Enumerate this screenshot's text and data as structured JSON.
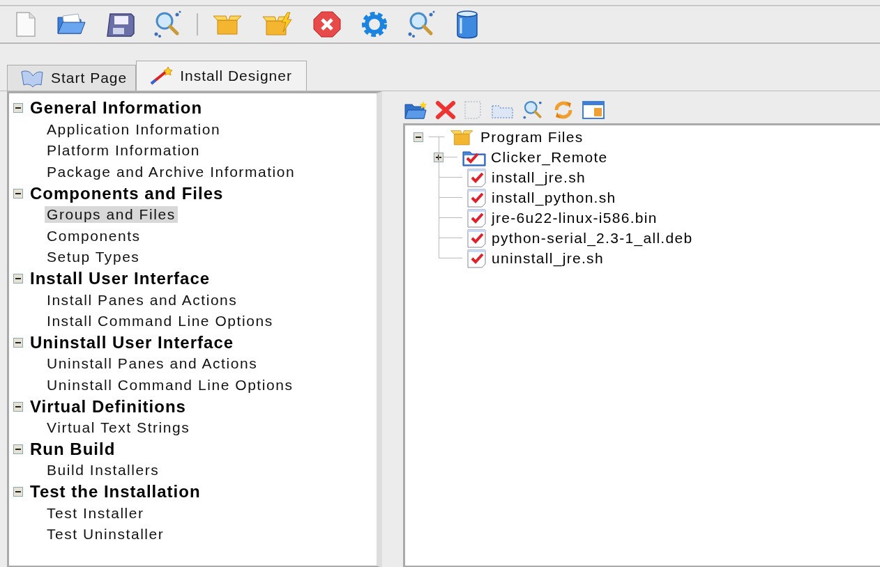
{
  "tabs": [
    {
      "label": "Start Page",
      "selected": false
    },
    {
      "label": "Install Designer",
      "selected": true
    }
  ],
  "sidebar": {
    "sections": [
      {
        "title": "General Information",
        "expanded": true,
        "items": [
          {
            "label": "Application Information",
            "selected": false
          },
          {
            "label": "Platform Information",
            "selected": false
          },
          {
            "label": "Package and Archive Information",
            "selected": false
          }
        ]
      },
      {
        "title": "Components and Files",
        "expanded": true,
        "items": [
          {
            "label": "Groups and Files",
            "selected": true
          },
          {
            "label": "Components",
            "selected": false
          },
          {
            "label": "Setup Types",
            "selected": false
          }
        ]
      },
      {
        "title": "Install User Interface",
        "expanded": true,
        "items": [
          {
            "label": "Install Panes and Actions",
            "selected": false
          },
          {
            "label": "Install Command Line Options",
            "selected": false
          }
        ]
      },
      {
        "title": "Uninstall User Interface",
        "expanded": true,
        "items": [
          {
            "label": "Uninstall Panes and Actions",
            "selected": false
          },
          {
            "label": "Uninstall Command Line Options",
            "selected": false
          }
        ]
      },
      {
        "title": "Virtual Definitions",
        "expanded": true,
        "items": [
          {
            "label": "Virtual Text Strings",
            "selected": false
          }
        ]
      },
      {
        "title": "Run Build",
        "expanded": true,
        "items": [
          {
            "label": "Build Installers",
            "selected": false
          }
        ]
      },
      {
        "title": "Test the Installation",
        "expanded": true,
        "items": [
          {
            "label": "Test Installer",
            "selected": false
          },
          {
            "label": "Test Uninstaller",
            "selected": false
          }
        ]
      }
    ]
  },
  "tree": {
    "label": "Program Files",
    "expanded": true,
    "children": [
      {
        "label": "Clicker_Remote",
        "kind": "folder",
        "checked": true,
        "expanded": false
      },
      {
        "label": "install_jre.sh",
        "kind": "file",
        "checked": true
      },
      {
        "label": "install_python.sh",
        "kind": "file",
        "checked": true
      },
      {
        "label": "jre-6u22-linux-i586.bin",
        "kind": "file",
        "checked": true
      },
      {
        "label": "python-serial_2.3-1_all.deb",
        "kind": "file",
        "checked": true
      },
      {
        "label": "uninstall_jre.sh",
        "kind": "file",
        "checked": true
      }
    ]
  }
}
